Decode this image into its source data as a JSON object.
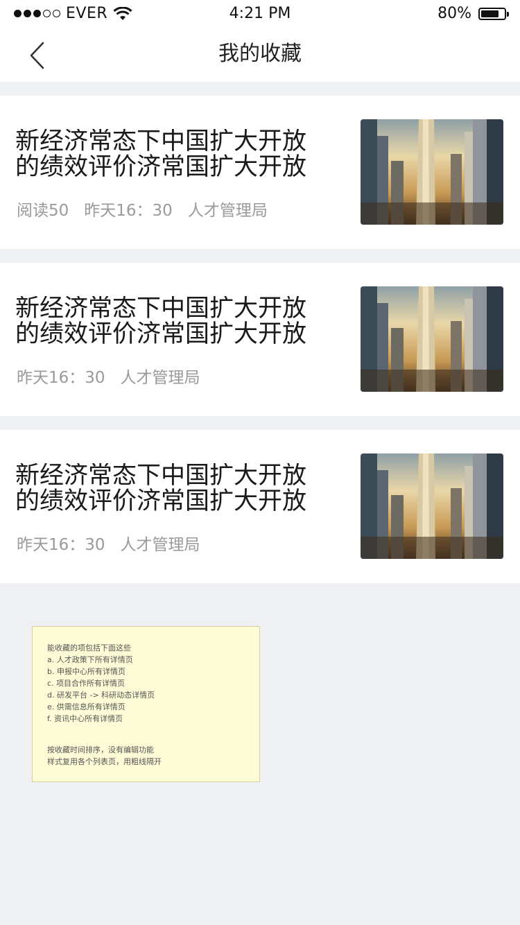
{
  "status_bar": {
    "carrier": "EVER",
    "time": "4:21 PM",
    "battery": "80%",
    "battery_level": 0.8
  },
  "nav": {
    "title": "我的收藏",
    "back_icon": "chevron-left-icon"
  },
  "articles": [
    {
      "title": "新经济常态下中国扩大开放的绩效评价济常国扩大开放",
      "reads": "阅读50",
      "time": "昨天16：30",
      "source": "人才管理局"
    },
    {
      "title": "新经济常态下中国扩大开放的绩效评价济常国扩大开放",
      "reads": "",
      "time": "昨天16：30",
      "source": "人才管理局"
    },
    {
      "title": "新经济常态下中国扩大开放的绩效评价济常国扩大开放",
      "reads": "",
      "time": "昨天16：30",
      "source": "人才管理局"
    }
  ],
  "note": {
    "heading": "能收藏的项包括下面这些",
    "items": [
      "a. 人才政策下所有详情页",
      "b. 申报中心所有详情页",
      "c. 项目合作所有详情页",
      "d. 研发平台 -> 科研动态详情页",
      "e. 供需信息所有详情页",
      "f. 资讯中心所有详情页"
    ],
    "footer": [
      "按收藏时间排序，没有编辑功能",
      "样式复用各个列表页，用粗线隔开"
    ]
  }
}
